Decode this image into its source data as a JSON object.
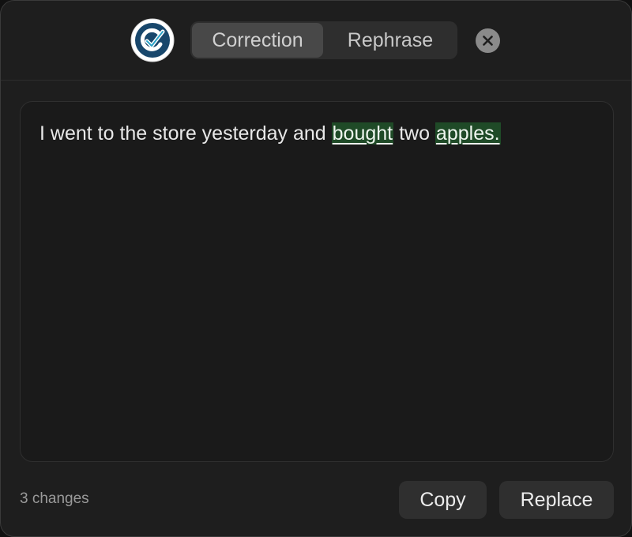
{
  "header": {
    "tabs": [
      {
        "label": "Correction",
        "active": true
      },
      {
        "label": "Rephrase",
        "active": false
      }
    ]
  },
  "editor": {
    "segments": [
      {
        "text": "I went to the store yesterday and ",
        "changed": false
      },
      {
        "text": "bought",
        "changed": true
      },
      {
        "text": " two ",
        "changed": false
      },
      {
        "text": "apples.",
        "changed": true
      }
    ]
  },
  "footer": {
    "changes_label": "3 changes",
    "copy_label": "Copy",
    "replace_label": "Replace"
  },
  "colors": {
    "window_bg": "#1e1e1e",
    "active_tab_bg": "#484848",
    "change_highlight": "#1f4a27",
    "logo_accent": "#1c4f7a"
  },
  "icons": {
    "logo": "checkmark-c-logo-icon",
    "close": "close-icon"
  }
}
